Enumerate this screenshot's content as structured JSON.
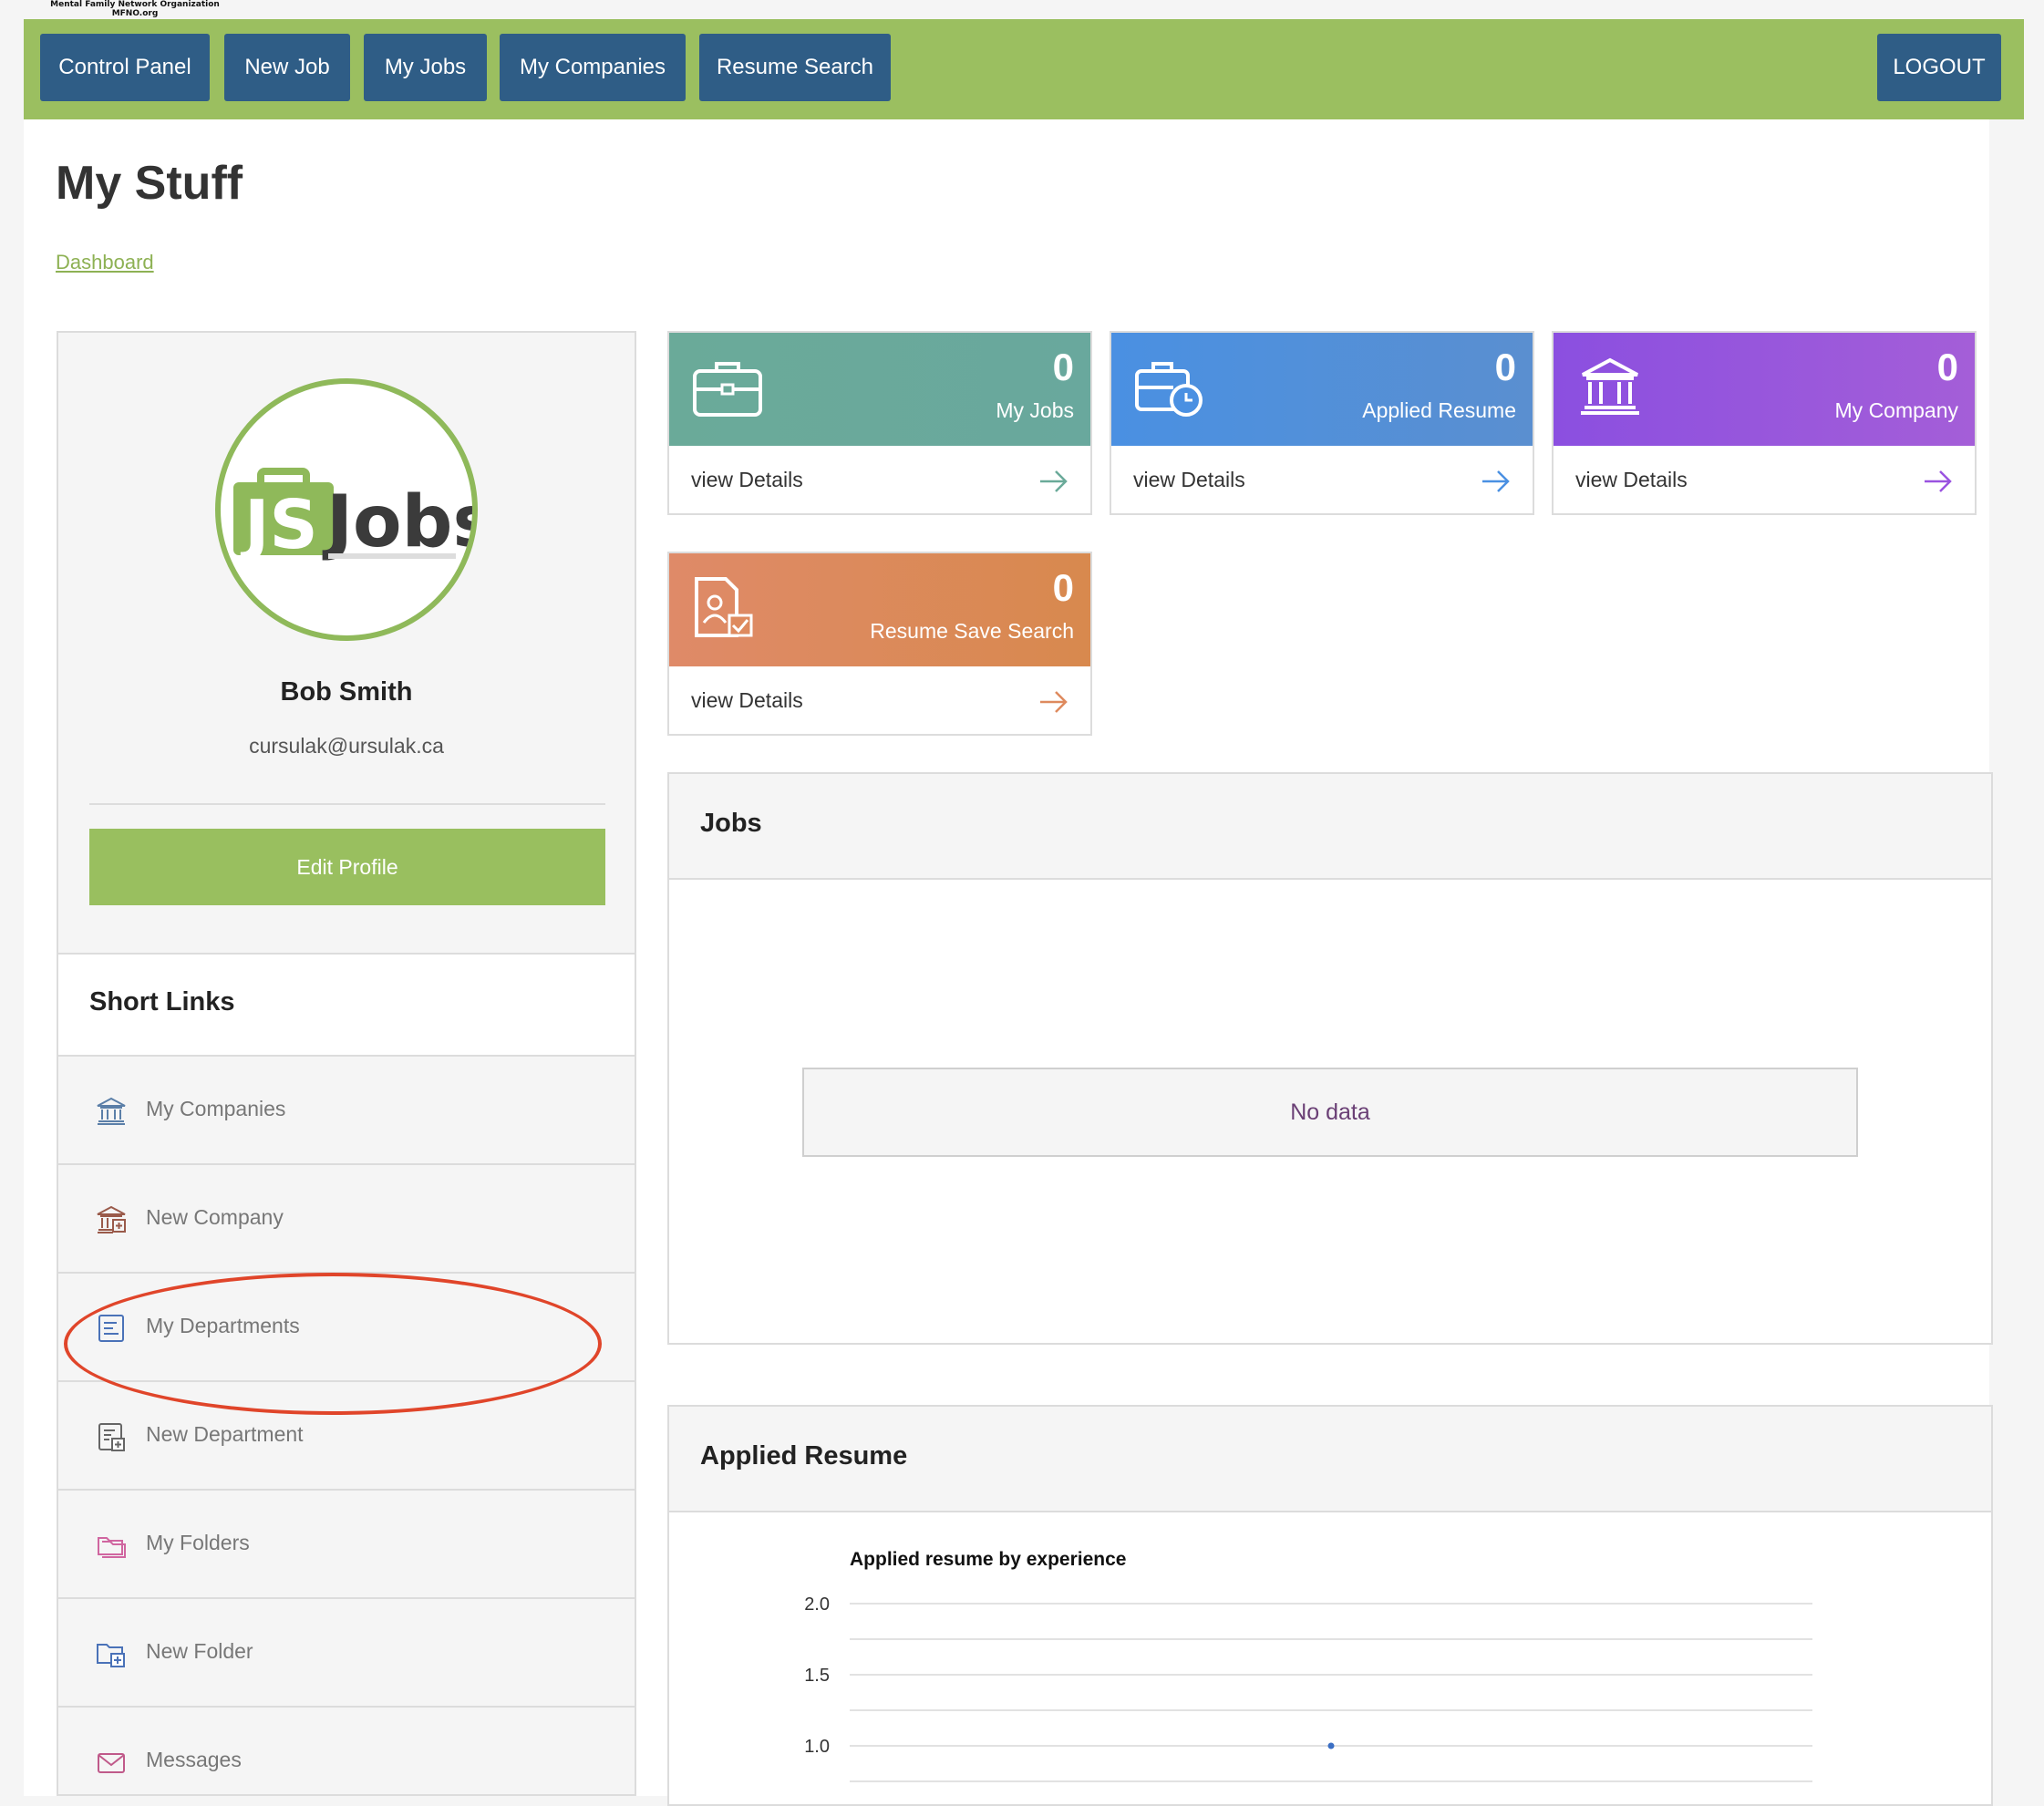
{
  "header": {
    "logo_lines": [
      "Mental Family Network Organization",
      "MFNO.org"
    ],
    "nav": [
      {
        "label": "Control Panel"
      },
      {
        "label": "New Job"
      },
      {
        "label": "My Jobs"
      },
      {
        "label": "My Companies"
      },
      {
        "label": "Resume Search"
      }
    ],
    "logout": "LOGOUT"
  },
  "page": {
    "title": "My Stuff",
    "breadcrumb": "Dashboard"
  },
  "profile": {
    "logo_text": "Jobs",
    "logo_initials": "JS",
    "name": "Bob Smith",
    "email": "cursulak@ursulak.ca",
    "edit_label": "Edit Profile"
  },
  "short_links": {
    "title": "Short Links",
    "items": [
      {
        "label": "My Companies",
        "icon": "bank-icon"
      },
      {
        "label": "New Company",
        "icon": "bank-add-icon"
      },
      {
        "label": "My Departments",
        "icon": "document-list-icon"
      },
      {
        "label": "New Department",
        "icon": "document-add-icon"
      },
      {
        "label": "My Folders",
        "icon": "folders-icon"
      },
      {
        "label": "New Folder",
        "icon": "folder-add-icon"
      },
      {
        "label": "Messages",
        "icon": "envelope-icon"
      }
    ]
  },
  "cards": [
    {
      "count": "0",
      "label": "My Jobs",
      "link": "view Details",
      "icon": "briefcase-icon",
      "color": "#6aaa99"
    },
    {
      "count": "0",
      "label": "Applied Resume",
      "link": "view Details",
      "icon": "briefcase-clock-icon",
      "color": "#4a90e2"
    },
    {
      "count": "0",
      "label": "My Company",
      "link": "view Details",
      "icon": "bank-icon",
      "color": "#9a53e0"
    },
    {
      "count": "0",
      "label": "Resume Save Search",
      "link": "view Details",
      "icon": "resume-check-icon",
      "color": "#de8a5e"
    }
  ],
  "jobs_panel": {
    "title": "Jobs",
    "empty": "No data"
  },
  "applied_panel": {
    "title": "Applied Resume"
  },
  "chart_data": {
    "type": "scatter",
    "title": "Applied resume by experience",
    "xlabel": "",
    "ylabel": "",
    "ylim": [
      1.0,
      2.0
    ],
    "yticks": [
      "2.0",
      "1.5",
      "1.0"
    ],
    "grid": true,
    "series": [
      {
        "points": [
          {
            "y": 1.0
          }
        ]
      }
    ]
  },
  "colors": {
    "nav_bg": "#9bbf60",
    "nav_button": "#2f5d86",
    "accent_green": "#99bf5f",
    "annotation_oval": "#e0452a"
  }
}
